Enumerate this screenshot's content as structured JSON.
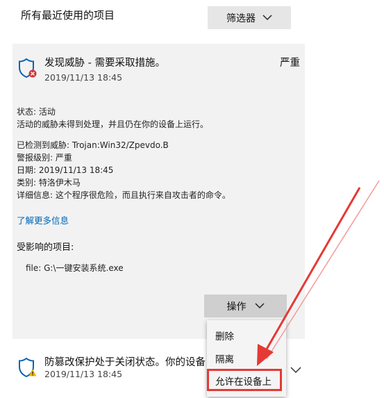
{
  "header": {
    "title": "所有最近使用的项目",
    "filter_label": "筛选器"
  },
  "threat": {
    "title": "发现威胁 - 需要采取措施。",
    "severity": "严重",
    "date": "2019/11/13 18:45",
    "status_line": "状态: 活动",
    "status_desc": "活动的威胁未得到处理，并且仍在你的设备上运行。",
    "detected": "已检测到威胁: Trojan:Win32/Zpevdo.B",
    "alert_level": "警报级别: 严重",
    "date_line": "日期:  2019/11/13 18:45",
    "category": "类别: 特洛伊木马",
    "details": "详细信息: 这个程序很危险，而且执行来自攻击者的命令。",
    "learn_more": "了解更多信息",
    "affected_heading": "受影响的项目:",
    "affected_file": "file: G:\\一键安装系统.exe",
    "action_label": "操作"
  },
  "action_menu": {
    "items": [
      "删除",
      "隔离",
      "允许在设备上"
    ]
  },
  "tamper": {
    "title": "防篡改保护处于关闭状态。你的设备",
    "date": "2019/11/13 18:45"
  },
  "colors": {
    "link": "#0067b8",
    "highlight": "#e53935",
    "shield": "#0a62b0",
    "error_badge": "#d13438",
    "warning_badge": "#f2b300"
  },
  "icons": [
    "shield-error-icon",
    "shield-warning-icon",
    "chevron-down-icon"
  ]
}
